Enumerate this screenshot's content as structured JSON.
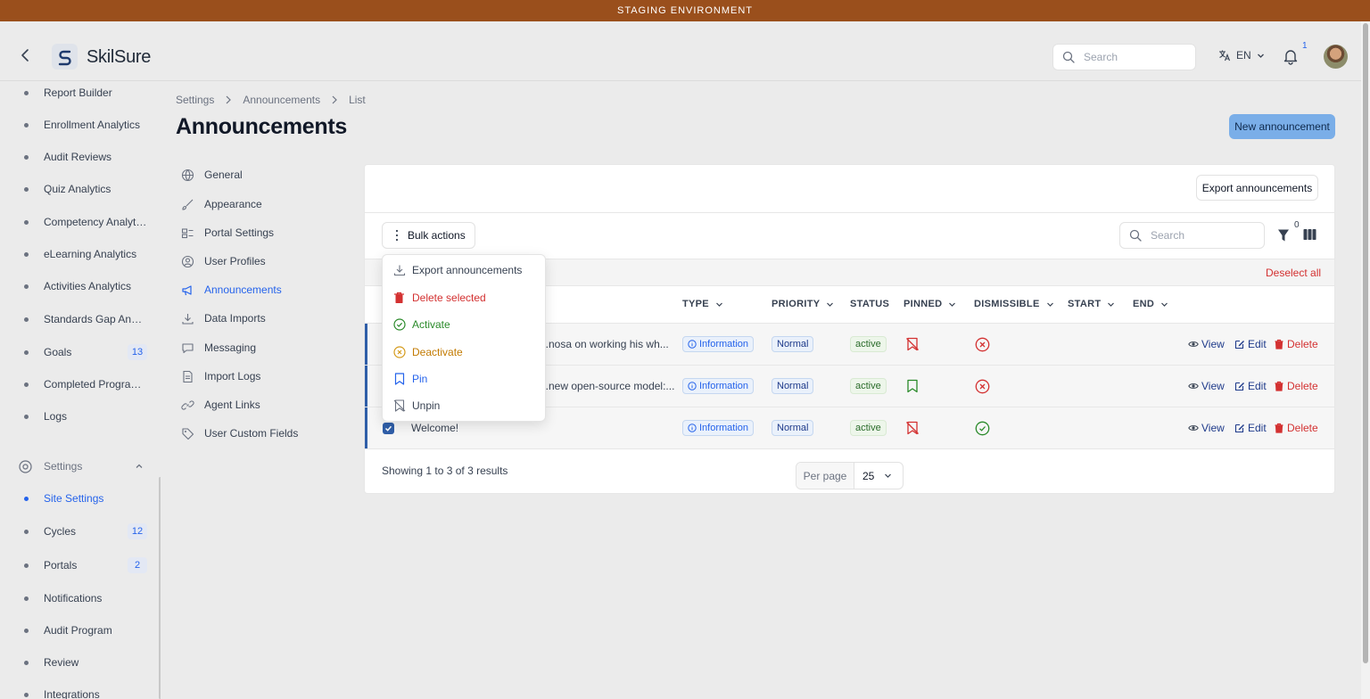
{
  "banner": {
    "text": "STAGING ENVIRONMENT"
  },
  "header": {
    "logo_text": "SkilSure",
    "search_placeholder": "Search",
    "language": "EN",
    "notification_count": "1"
  },
  "sidebar": {
    "items": [
      {
        "label": "Report Builder"
      },
      {
        "label": "Enrollment Analytics"
      },
      {
        "label": "Audit Reviews"
      },
      {
        "label": "Quiz Analytics"
      },
      {
        "label": "Competency Analytics"
      },
      {
        "label": "eLearning Analytics"
      },
      {
        "label": "Activities Analytics"
      },
      {
        "label": "Standards Gap Analy..."
      },
      {
        "label": "Goals",
        "badge": "13"
      },
      {
        "label": "Completed Program ..."
      },
      {
        "label": "Logs"
      }
    ],
    "section_label": "Settings",
    "settings_items": [
      {
        "label": "Site Settings"
      },
      {
        "label": "Cycles",
        "badge": "12"
      },
      {
        "label": "Portals",
        "badge": "2"
      },
      {
        "label": "Notifications"
      },
      {
        "label": "Audit Program"
      },
      {
        "label": "Review"
      },
      {
        "label": "Integrations"
      }
    ]
  },
  "breadcrumb": [
    "Settings",
    "Announcements",
    "List"
  ],
  "page": {
    "title": "Announcements",
    "new_button": "New announcement"
  },
  "settings_nav": [
    {
      "label": "General",
      "icon": "globe-icon"
    },
    {
      "label": "Appearance",
      "icon": "brush-icon"
    },
    {
      "label": "Portal Settings",
      "icon": "portal-icon"
    },
    {
      "label": "User Profiles",
      "icon": "user-circle-icon"
    },
    {
      "label": "Announcements",
      "icon": "megaphone-icon"
    },
    {
      "label": "Data Imports",
      "icon": "download-icon"
    },
    {
      "label": "Messaging",
      "icon": "chat-icon"
    },
    {
      "label": "Import Logs",
      "icon": "document-icon"
    },
    {
      "label": "Agent Links",
      "icon": "link-icon"
    },
    {
      "label": "User Custom Fields",
      "icon": "tag-icon"
    }
  ],
  "table": {
    "export_button": "Export announcements",
    "bulk_actions": "Bulk actions",
    "search_placeholder": "Search",
    "filter_count": "0",
    "deselect_all": "Deselect all",
    "columns": {
      "type": "TYPE",
      "priority": "PRIORITY",
      "status": "STATUS",
      "pinned": "PINNED",
      "dismissible": "DISMISSIBLE",
      "start": "START",
      "end": "END"
    },
    "rows": [
      {
        "title": "...nosa on working his wh...",
        "type": "Information",
        "priority": "Normal",
        "status": "active",
        "pinned": false,
        "dismissible": false
      },
      {
        "title": "...new open-source model:...",
        "type": "Information",
        "priority": "Normal",
        "status": "active",
        "pinned": true,
        "dismissible": false
      },
      {
        "title": "Welcome!",
        "type": "Information",
        "priority": "Normal",
        "status": "active",
        "pinned": false,
        "dismissible": true
      }
    ],
    "actions": {
      "view": "View",
      "edit": "Edit",
      "delete": "Delete"
    },
    "showing": "Showing 1 to 3 of 3 results",
    "per_page_label": "Per page",
    "per_page_value": "25"
  },
  "bulk_menu": {
    "items": [
      {
        "label": "Export announcements",
        "color": "#374151"
      },
      {
        "label": "Delete selected",
        "color": "#d33131"
      },
      {
        "label": "Activate",
        "color": "#2a8a2a"
      },
      {
        "label": "Deactivate",
        "color": "#c27a00"
      },
      {
        "label": "Pin",
        "color": "#2563eb"
      },
      {
        "label": "Unpin",
        "color": "#374151"
      }
    ]
  }
}
